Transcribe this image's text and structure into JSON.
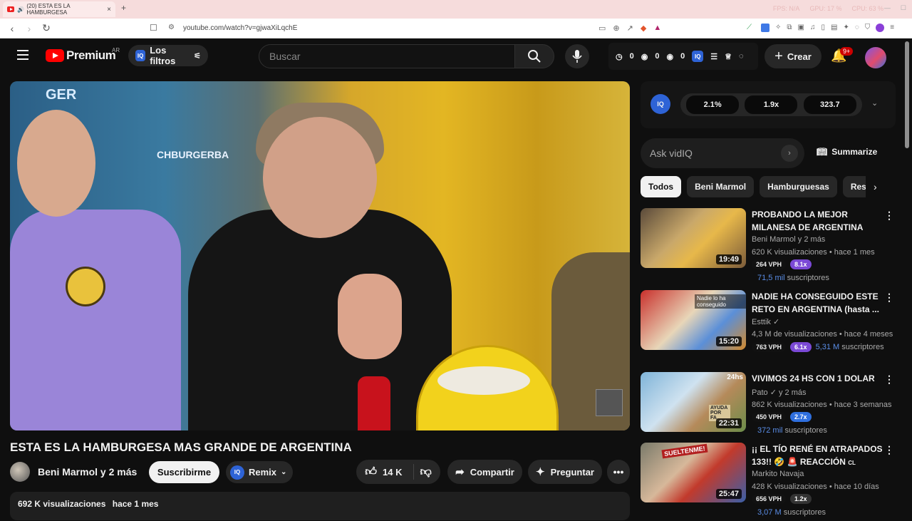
{
  "browser": {
    "tab_title": "(20) ESTA ES LA HAMBURGESA",
    "new_tab": "+",
    "url": "youtube.com/watch?v=gjwaXiLqchE",
    "perf": [
      "FPS: N/A",
      "GPU: 17 %",
      "CPU: 63 %"
    ]
  },
  "header": {
    "logo_text": "Premium",
    "region": "AR",
    "filters_label": "Los filtros",
    "search_placeholder": "Buscar",
    "stats": [
      "0",
      "0",
      "0"
    ],
    "create_label": "Crear",
    "notif_badge": "9+"
  },
  "video": {
    "sign_text": "CHBURGERBA",
    "sign_text2": "GER",
    "title": "ESTA ES LA HAMBURGESA MAS GRANDE DE ARGENTINA",
    "channel": "Beni Marmol y 2 más",
    "subscribe": "Suscribirme",
    "remix": "Remix",
    "likes": "14 K",
    "share": "Compartir",
    "ask": "Preguntar",
    "views": "692 K visualizaciones",
    "date": "hace 1 mes"
  },
  "vidiq": {
    "logo": "IQ",
    "metrics": [
      "2.1%",
      "1.9x",
      "323.7"
    ],
    "ask_placeholder": "Ask vidIQ",
    "summarize": "Summarize"
  },
  "chips": [
    "Todos",
    "Beni Marmol",
    "Hamburguesas",
    "Restaurantes"
  ],
  "recommendations": [
    {
      "title_1": "PROBANDO LA MEJOR",
      "title_2": "MILANESA DE ARGENTINA",
      "channel": "Beni Marmol y 2 más",
      "stats": "620 K visualizaciones • hace 1 mes",
      "duration": "19:49",
      "vph": "264 VPH",
      "mult": "8.1x",
      "mult_color": "#7b49d6",
      "subs_num": "71,5 mil",
      "subs_label": "suscriptores"
    },
    {
      "title_1": "NADIE HA CONSEGUIDO ESTE",
      "title_2": "RETO EN ARGENTINA (hasta ...",
      "channel": "Esttik",
      "stats": "4,3 M de visualizaciones • hace 4 meses",
      "duration": "15:20",
      "vph": "763 VPH",
      "mult": "6.1x",
      "mult_color": "#7b49d6",
      "subs_num": "5,31 M",
      "subs_label": "suscriptores",
      "thumb_text": "Nadie lo ha conseguido"
    },
    {
      "title_1": "VIVIMOS 24 HS CON 1 DOLAR",
      "title_2": "",
      "channel": "Pato",
      "channel_suffix": "y 2 más",
      "stats": "862 K visualizaciones • hace 3 semanas",
      "duration": "22:31",
      "vph": "450 VPH",
      "mult": "2.7x",
      "mult_color": "#2f6fde",
      "subs_num": "372 mil",
      "subs_label": "suscriptores",
      "thumb_text": "24hs",
      "thumb_text2": "AYUDA POR FA"
    },
    {
      "title_1": "¡¡ EL TÍO RENÉ EN ATRAPADOS",
      "title_2": "133!! 🤣 🚨 REACCIÓN",
      "title_suffix": "CL",
      "channel": "Markito Navaja",
      "stats": "428 K visualizaciones • hace 10 días",
      "duration": "25:47",
      "vph": "656 VPH",
      "mult": "1.2x",
      "mult_color": "#333333",
      "subs_num": "3,07 M",
      "subs_label": "suscriptores",
      "thumb_text": "SUELTENME!"
    }
  ]
}
